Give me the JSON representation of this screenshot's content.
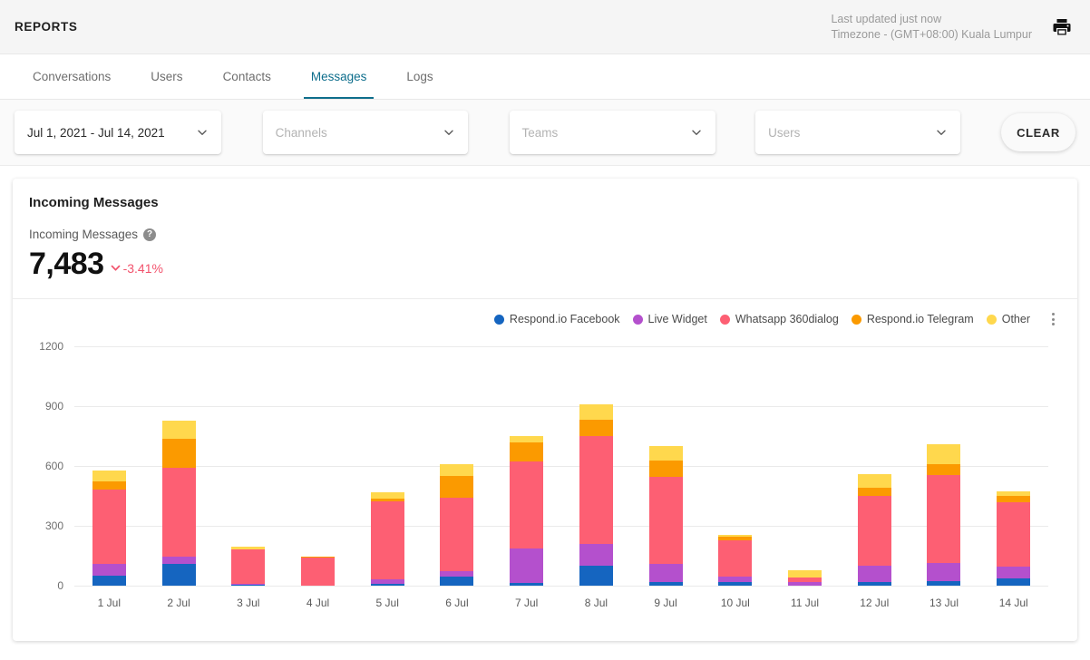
{
  "header": {
    "title": "REPORTS",
    "last_updated": "Last updated just now",
    "timezone": "Timezone - (GMT+08:00) Kuala Lumpur",
    "print_icon": "printer-icon"
  },
  "tabs": [
    {
      "label": "Conversations",
      "active": false
    },
    {
      "label": "Users",
      "active": false
    },
    {
      "label": "Contacts",
      "active": false
    },
    {
      "label": "Messages",
      "active": true
    },
    {
      "label": "Logs",
      "active": false
    }
  ],
  "filters": {
    "date_range": {
      "value": "Jul 1, 2021 - Jul 14, 2021",
      "placeholder": "Date range",
      "is_placeholder": false
    },
    "channels": {
      "value": "Channels",
      "placeholder": "Channels",
      "is_placeholder": true
    },
    "teams": {
      "value": "Teams",
      "placeholder": "Teams",
      "is_placeholder": true
    },
    "users": {
      "value": "Users",
      "placeholder": "Users",
      "is_placeholder": true
    },
    "clear_label": "CLEAR"
  },
  "card": {
    "title": "Incoming Messages",
    "kpi_label": "Incoming Messages",
    "help_glyph": "?",
    "kpi_value": "7,483",
    "kpi_delta": "-3.41%",
    "kpi_delta_direction": "down",
    "kpi_delta_color": "#f2536d"
  },
  "chart_data": {
    "type": "bar",
    "stacked": true,
    "title": "Incoming Messages",
    "xlabel": "",
    "ylabel": "",
    "ylim": [
      0,
      1200
    ],
    "yticks": [
      0,
      300,
      600,
      900,
      1200
    ],
    "grid": true,
    "legend_position": "top-right",
    "categories": [
      "1 Jul",
      "2 Jul",
      "3 Jul",
      "4 Jul",
      "5 Jul",
      "6 Jul",
      "7 Jul",
      "8 Jul",
      "9 Jul",
      "10 Jul",
      "11 Jul",
      "12 Jul",
      "13 Jul",
      "14 Jul"
    ],
    "series": [
      {
        "name": "Respond.io Facebook",
        "color": "#1565c0",
        "values": [
          50,
          110,
          5,
          0,
          8,
          45,
          12,
          100,
          18,
          18,
          0,
          18,
          25,
          38
        ]
      },
      {
        "name": "Live Widget",
        "color": "#b450cd",
        "values": [
          60,
          35,
          4,
          0,
          25,
          30,
          175,
          110,
          92,
          26,
          18,
          80,
          90,
          58
        ]
      },
      {
        "name": "Whatsapp 360dialog",
        "color": "#fd5f73",
        "values": [
          370,
          445,
          172,
          140,
          392,
          365,
          438,
          540,
          435,
          185,
          22,
          350,
          440,
          322
        ]
      },
      {
        "name": "Respond.io Telegram",
        "color": "#fb9a00",
        "values": [
          42,
          148,
          2,
          4,
          10,
          110,
          95,
          82,
          82,
          18,
          0,
          42,
          55,
          32
        ]
      },
      {
        "name": "Other",
        "color": "#ffd84d",
        "values": [
          55,
          90,
          14,
          0,
          32,
          60,
          32,
          78,
          73,
          10,
          38,
          68,
          100,
          22
        ]
      }
    ]
  }
}
